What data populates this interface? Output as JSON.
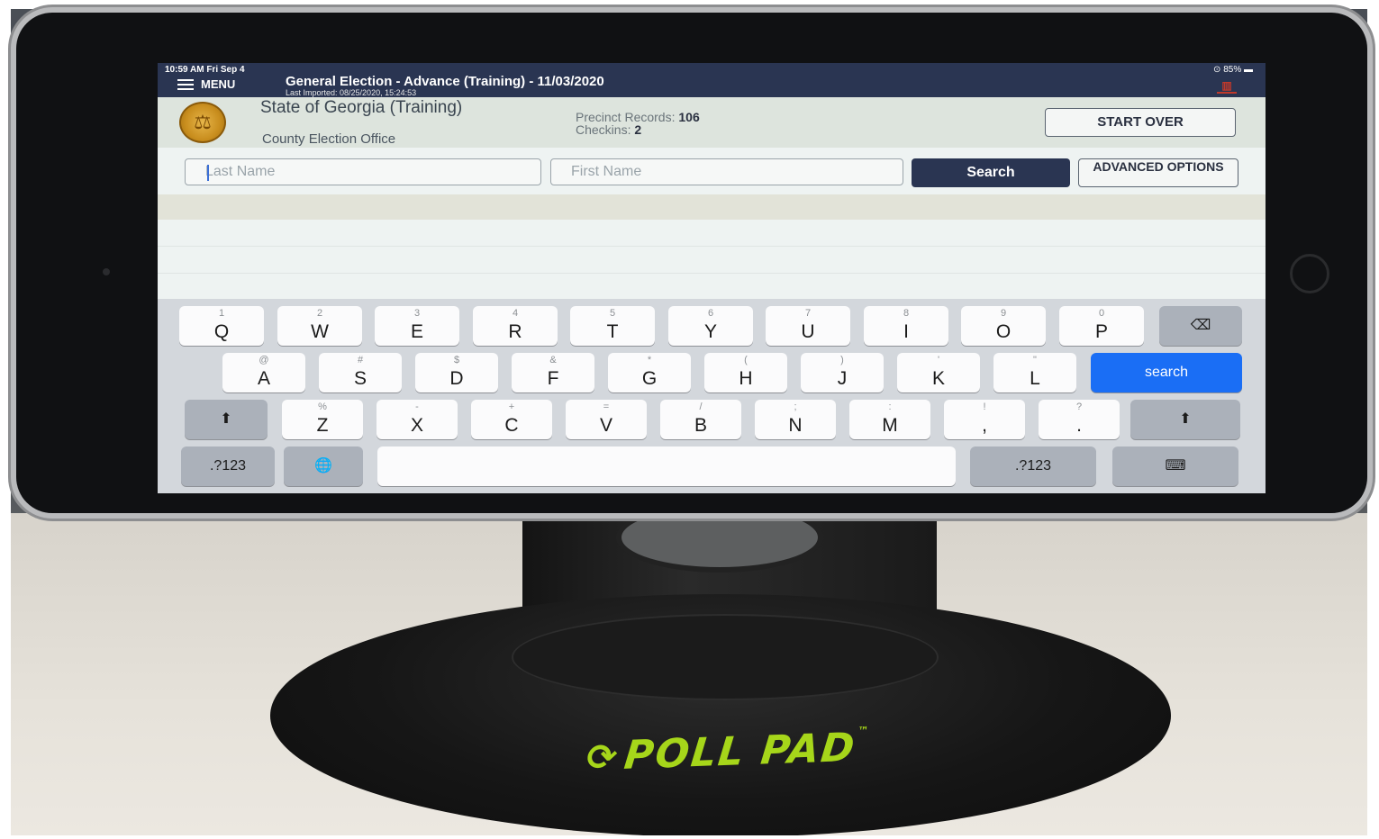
{
  "status_bar": {
    "time": "10:59 AM  Fri Sep 4",
    "battery": "⊙ 85% ▬"
  },
  "topbar": {
    "menu_label": "MENU",
    "election_title": "General Election - Advance (Training) - 11/03/2020",
    "last_imported": "Last Imported: 08/25/2020, 15:24:53"
  },
  "header": {
    "org_name": "State of Georgia (Training)",
    "org_sub": "County Election Office",
    "precinct_label": "Precinct Records:",
    "precinct_value": "106",
    "checkins_label": "Checkins:",
    "checkins_value": "2",
    "start_over": "START OVER"
  },
  "search": {
    "last_name_placeholder": "Last Name",
    "first_name_placeholder": "First Name",
    "search_label": "Search",
    "advanced_label": "ADVANCED OPTIONS"
  },
  "keyboard": {
    "row1": [
      {
        "sub": "1",
        "main": "Q"
      },
      {
        "sub": "2",
        "main": "W"
      },
      {
        "sub": "3",
        "main": "E"
      },
      {
        "sub": "4",
        "main": "R"
      },
      {
        "sub": "5",
        "main": "T"
      },
      {
        "sub": "6",
        "main": "Y"
      },
      {
        "sub": "7",
        "main": "U"
      },
      {
        "sub": "8",
        "main": "I"
      },
      {
        "sub": "9",
        "main": "O"
      },
      {
        "sub": "0",
        "main": "P"
      }
    ],
    "row2": [
      {
        "sub": "@",
        "main": "A"
      },
      {
        "sub": "#",
        "main": "S"
      },
      {
        "sub": "$",
        "main": "D"
      },
      {
        "sub": "&",
        "main": "F"
      },
      {
        "sub": "*",
        "main": "G"
      },
      {
        "sub": "(",
        "main": "H"
      },
      {
        "sub": ")",
        "main": "J"
      },
      {
        "sub": "'",
        "main": "K"
      },
      {
        "sub": "\"",
        "main": "L"
      }
    ],
    "row3": [
      {
        "sub": "%",
        "main": "Z"
      },
      {
        "sub": "-",
        "main": "X"
      },
      {
        "sub": "+",
        "main": "C"
      },
      {
        "sub": "=",
        "main": "V"
      },
      {
        "sub": "/",
        "main": "B"
      },
      {
        "sub": ";",
        "main": "N"
      },
      {
        "sub": ":",
        "main": "M"
      },
      {
        "sub": "!",
        "main": ","
      },
      {
        "sub": "?",
        "main": "."
      }
    ],
    "search_key": "search",
    "numbers_key": ".?123",
    "delete_glyph": "⌫",
    "shift_glyph": "⬆",
    "globe_glyph": "🌐",
    "hide_glyph": "⌨"
  },
  "stand": {
    "brand": "POLL PAD",
    "brand_tm": "™",
    "brand_symbol": "⟳"
  }
}
